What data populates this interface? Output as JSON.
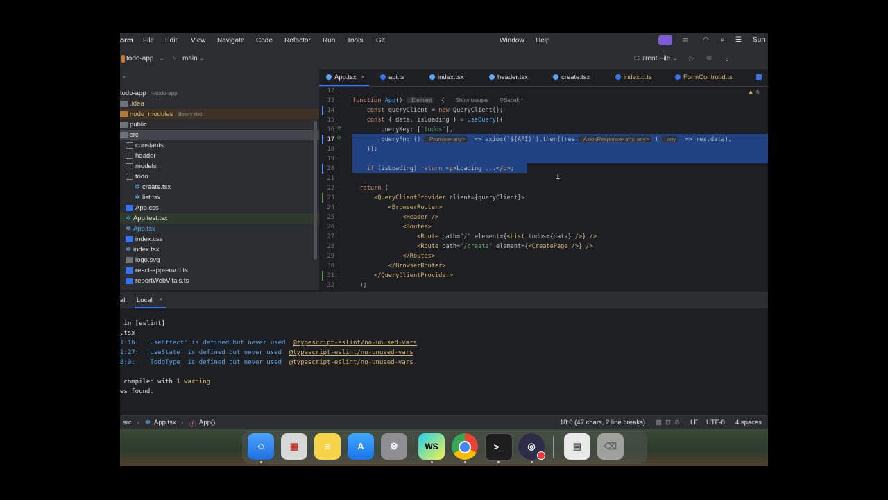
{
  "menubar": {
    "app_name": "orm",
    "items": [
      "File",
      "Edit",
      "View",
      "Navigate",
      "Code",
      "Refactor",
      "Run",
      "Tools",
      "Git",
      "Window",
      "Help"
    ],
    "clock": "Sun"
  },
  "toolbar": {
    "project": "todo-app",
    "branch": "main",
    "run_config": "Current File"
  },
  "tree": {
    "items": [
      {
        "label": "todo-app",
        "extra": "~/todo-app"
      },
      {
        "label": ".idea"
      },
      {
        "label": "node_modules",
        "extra": "library root"
      },
      {
        "label": "public"
      },
      {
        "label": "src"
      },
      {
        "label": "constants"
      },
      {
        "label": "header"
      },
      {
        "label": "models"
      },
      {
        "label": "todo"
      },
      {
        "label": "create.tsx"
      },
      {
        "label": "list.tsx"
      },
      {
        "label": "App.css"
      },
      {
        "label": "App.test.tsx"
      },
      {
        "label": "App.tsx"
      },
      {
        "label": "index.css"
      },
      {
        "label": "index.tsx"
      },
      {
        "label": "logo.svg"
      },
      {
        "label": "react-app-env.d.ts"
      },
      {
        "label": "reportWebVitals.ts"
      }
    ]
  },
  "tabs": [
    "App.tsx",
    "api.ts",
    "index.tsx",
    "header.tsx",
    "create.tsx",
    "index.d.ts",
    "FormControl.d.ts"
  ],
  "editor": {
    "problems_count": "6",
    "line_numbers": [
      "12",
      "13",
      "14",
      "15",
      "16",
      "17",
      "18",
      "19",
      "20",
      "21",
      "22",
      "23",
      "24",
      "25",
      "26",
      "27",
      "28",
      "29",
      "30",
      "31",
      "32"
    ],
    "hints": {
      "element": ": Element",
      "show_usages": "Show usages",
      "author": "Babak *",
      "promise": ": Promise<any>",
      "axios_response": ": AxiosResponse<any, any>",
      "any": ": any"
    }
  },
  "terminal": {
    "tabs": [
      "al",
      "Local"
    ],
    "lines": [
      " in [eslint]",
      ".tsx",
      "1:16:  'useEffect' is defined but never used  ",
      "1:27:  'useState' is defined but never used  ",
      "8:9:   'TodoType' is defined but never used  ",
      "",
      " compiled with ",
      "es found."
    ],
    "rule": "@typescript-eslint/no-unused-vars",
    "warning_text": "1 warning"
  },
  "statusbar": {
    "crumbs": [
      "src",
      "App.tsx",
      "App()"
    ],
    "position": "18:8 (47 chars, 2 line breaks)",
    "line_ending": "LF",
    "encoding": "UTF-8",
    "indent": "4 spaces"
  },
  "dock": {
    "apps": [
      "finder-icon",
      "launchpad-icon",
      "notes-icon",
      "app-store-icon",
      "settings-icon",
      "webstorm-icon",
      "chrome-icon",
      "terminal-icon",
      "obs-icon",
      "preview-icon",
      "trash-icon"
    ],
    "webstorm_label": "WS"
  }
}
